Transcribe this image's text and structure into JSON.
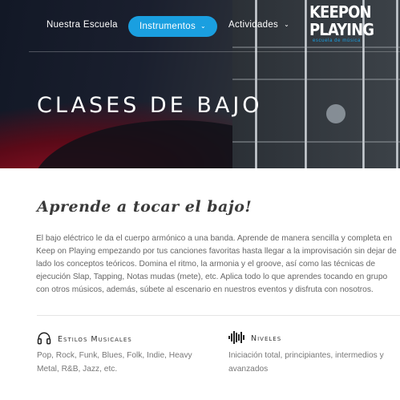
{
  "nav": {
    "links": [
      "Nuestra Escuela",
      "Instrumentos",
      "Actividades"
    ],
    "active": "Instrumentos"
  },
  "logo": {
    "line1": "KEEPON",
    "line2": "PLAYING",
    "sub": "escuela de música"
  },
  "hero": {
    "title": "CLASES DE BAJO"
  },
  "content": {
    "subtitle": "Aprende a tocar el bajo!",
    "body": "El bajo eléctrico le da el cuerpo armónico a una banda. Aprende de manera sencilla y completa en Keep on Playing empezando por tus canciones favoritas hasta llegar a la improvisación sin dejar de lado los conceptos teóricos. Domina el ritmo, la armonia y el groove, así como las técnicas de ejecución Slap, Tapping, Notas mudas (mete), etc. Aplica todo lo que aprendes tocando en grupo con otros músicos, además, súbete al escenario en nuestros eventos y disfruta con nosotros."
  },
  "features": [
    {
      "icon": "headphones-icon",
      "title": "Estilos Musicales",
      "text": "Pop, Rock, Funk, Blues, Folk, Indie, Heavy Metal, R&B, Jazz, etc."
    },
    {
      "icon": "sound-bars-icon",
      "title": "Niveles",
      "text": "Iniciación total, principiantes, intermedios y avanzados"
    }
  ],
  "colors": {
    "accent": "#1a9fe0",
    "heroDark": "#121826",
    "heroRed": "#8a0f22"
  }
}
